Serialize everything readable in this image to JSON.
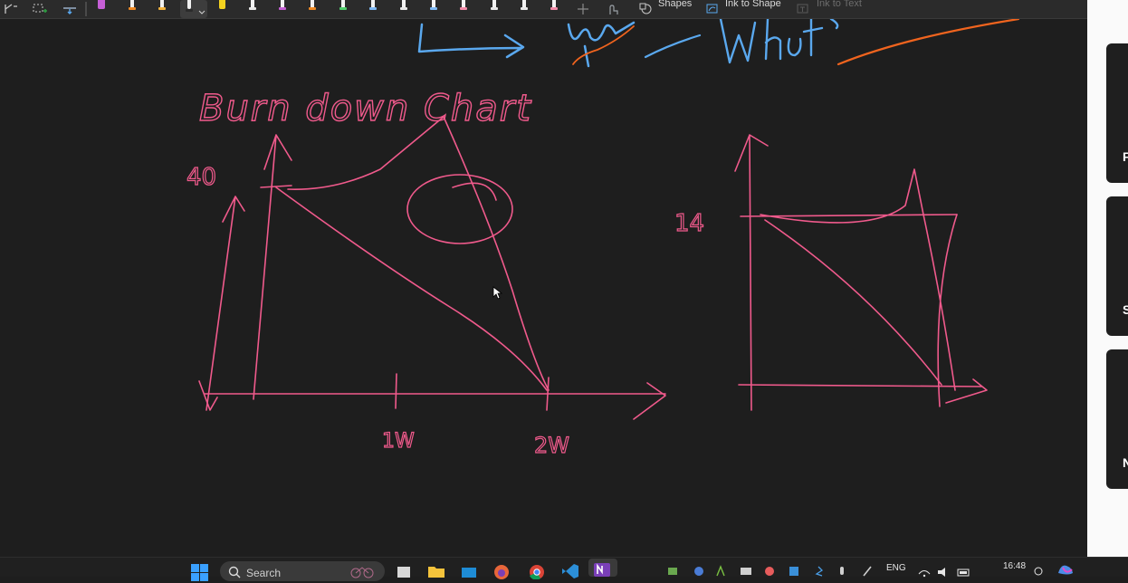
{
  "toolbar": {
    "shapes_label": "Shapes",
    "ink_to_shape_label": "Ink to Shape",
    "ink_to_text_label": "Ink to Text",
    "pen_colors": [
      "#c65fd6",
      "#f08a24",
      "#f3b33d",
      "#e9e9e9",
      "#f4d21f",
      "#e9e9e9",
      "#e9e9e9",
      "#f38aa8",
      "#f08a24",
      "#4fcf6c",
      "#7eb9f5",
      "#e9e9e9",
      "#f38aa8",
      "#e9e9e9",
      "#e9e9e9",
      "#f38aa8"
    ],
    "icons": [
      "lasso-select-icon",
      "add-space-icon",
      "eraser-icon",
      "pen-icon",
      "plus-icon",
      "touch-draw-icon",
      "shapes-icon",
      "ink-to-shape-icon",
      "ink-to-text-icon"
    ]
  },
  "canvas": {
    "title": "Burn down Chart",
    "left_chart_y": "40",
    "left_chart_x1": "1W",
    "left_chart_x2": "2W",
    "right_chart_y": "14",
    "top_fragment_1": "Sprint",
    "top_fragment_2": "What",
    "ink_pink": "#f05a8c",
    "ink_blue": "#5aa8ee",
    "ink_orange": "#f0641e"
  },
  "right_panel": {
    "letters": [
      "F",
      "S",
      "N"
    ]
  },
  "taskbar": {
    "search_placeholder": "Search",
    "language": "ENG",
    "time": "16:48",
    "icons": [
      "start-icon",
      "search-icon",
      "task-view-icon",
      "file-explorer-icon",
      "store-icon",
      "firefox-icon",
      "chrome-icon",
      "vscode-icon",
      "onenote-icon",
      "wifi-icon",
      "volume-icon",
      "battery-icon"
    ]
  }
}
